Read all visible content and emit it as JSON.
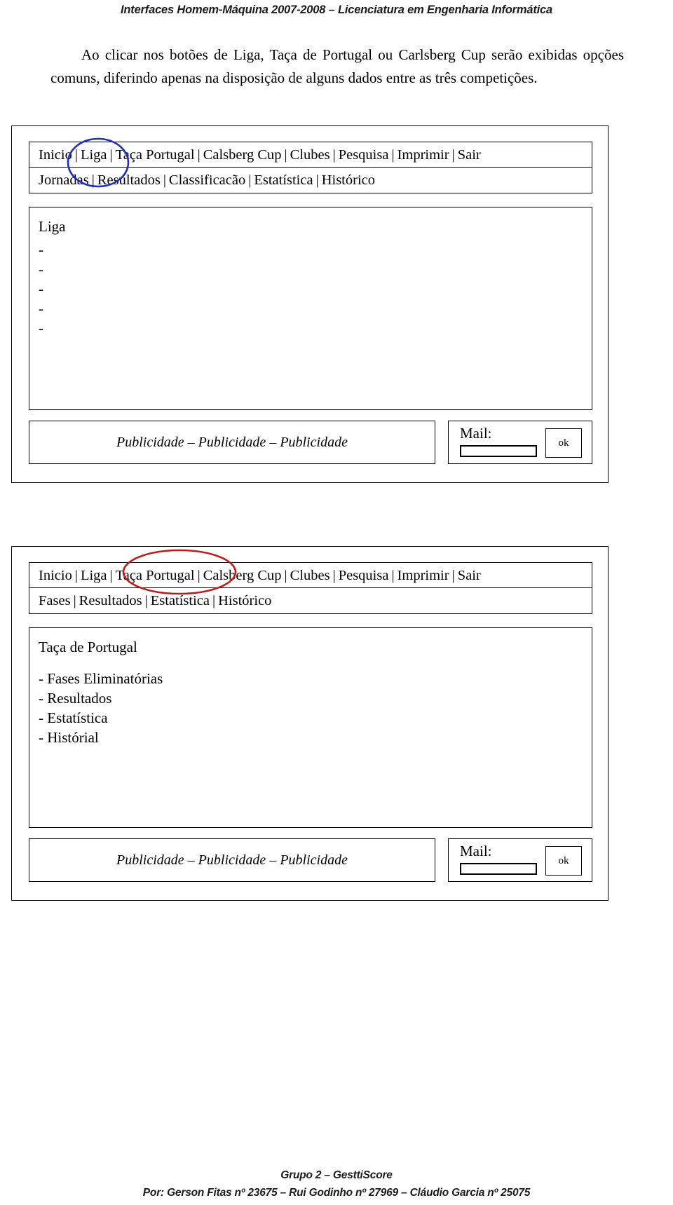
{
  "header": {
    "title": "Interfaces Homem-Máquina 2007-2008 –  Licenciatura em Engenharia Informática"
  },
  "intro": {
    "paragraph": "Ao clicar nos botões de Liga, Taça de Portugal ou Carlsberg Cup serão exibidas opções comuns, diferindo apenas na disposição de alguns dados entre as três competições."
  },
  "mockups": [
    {
      "id": "liga",
      "annotation": {
        "shape": "ellipse",
        "color": "#2230b8",
        "target_label": "Liga"
      },
      "primary_nav": {
        "separator": "|",
        "items": [
          {
            "label": "Inicio"
          },
          {
            "label": "Liga"
          },
          {
            "label": "Taça Portugal"
          },
          {
            "label": "Calsberg Cup"
          },
          {
            "label": "Clubes"
          },
          {
            "label": "Pesquisa"
          },
          {
            "label": "Imprimir"
          },
          {
            "label": "Sair"
          }
        ]
      },
      "secondary_nav": {
        "separator": "|",
        "items": [
          {
            "label": "Jornadas"
          },
          {
            "label": "Resultados"
          },
          {
            "label": "Classificacão"
          },
          {
            "label": "Estatística"
          },
          {
            "label": "Histórico"
          }
        ]
      },
      "panel": {
        "title": "Liga",
        "items": [
          "-",
          "-",
          "-",
          "-",
          "-"
        ]
      },
      "ad": {
        "text": "Publicidade – Publicidade – Publicidade"
      },
      "mail": {
        "label": "Mail:",
        "value": "",
        "placeholder": "",
        "button_label": "ok"
      }
    },
    {
      "id": "taca",
      "annotation": {
        "shape": "ellipse",
        "color": "#b81d1d",
        "target_label": "Taça Portugal"
      },
      "primary_nav": {
        "separator": "|",
        "items": [
          {
            "label": "Inicio"
          },
          {
            "label": "Liga"
          },
          {
            "label": "Taça Portugal"
          },
          {
            "label": "Calsberg Cup"
          },
          {
            "label": "Clubes"
          },
          {
            "label": "Pesquisa"
          },
          {
            "label": "Imprimir"
          },
          {
            "label": "Sair"
          }
        ]
      },
      "secondary_nav": {
        "separator": "|",
        "items": [
          {
            "label": "Fases"
          },
          {
            "label": "Resultados"
          },
          {
            "label": "Estatística"
          },
          {
            "label": "Histórico"
          }
        ]
      },
      "panel": {
        "title": "Taça de Portugal",
        "items": [
          "- Fases Eliminatórias",
          "- Resultados",
          "- Estatística",
          "- Histórial"
        ]
      },
      "ad": {
        "text": "Publicidade – Publicidade – Publicidade"
      },
      "mail": {
        "label": "Mail:",
        "value": "",
        "placeholder": "",
        "button_label": "ok"
      }
    }
  ],
  "footer": {
    "line1": "Grupo 2 – GesttiScore",
    "line2": "Por: Gerson Fitas nº 23675 – Rui Godinho nº 27969 – Cláudio Garcia nº 25075"
  }
}
